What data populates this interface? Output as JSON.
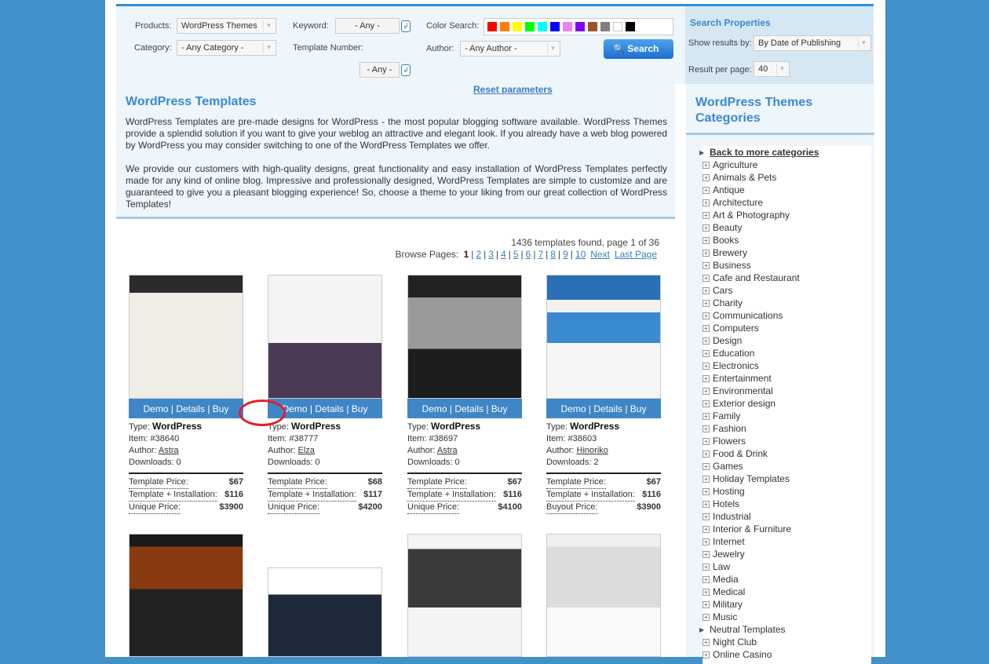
{
  "filters": {
    "products_label": "Products:",
    "products_value": "WordPress Themes",
    "category_label": "Category:",
    "category_value": "- Any Category -",
    "keyword_label": "Keyword:",
    "keyword_value": "- Any -",
    "template_number_label": "Template Number:",
    "template_number_value": "- Any -",
    "color_label": "Color Search:",
    "colors": [
      "#ff0000",
      "#ff8000",
      "#ffff00",
      "#00ff00",
      "#00ffff",
      "#0000ff",
      "#ee82ee",
      "#8000ff",
      "#a0522d",
      "#808080",
      "#ffffff",
      "#000000"
    ],
    "author_label": "Author:",
    "author_value": "- Any Author -",
    "search_label": "Search",
    "reset_label": "Reset parameters"
  },
  "properties": {
    "title": "Search Properties",
    "show_label": "Show results by:",
    "show_value": "By Date of Publishing",
    "per_page_label": "Result per page:",
    "per_page_value": "40"
  },
  "intro": {
    "title": "WordPress Templates",
    "p1": "WordPress Templates are pre-made designs for WordPress - the most popular blogging software available. WordPress Themes provide a splendid solution if you want to give your weblog an attractive and elegant look. If you already have a web blog powered by WordPress you may consider switching to one of the WordPress Templates we offer.",
    "p2": "We provide our customers with high-quality designs, great functionality and easy installation of WordPress Templates perfectly made for any kind of online blog. Impressive and professionally designed, WordPress Templates are simple to customize and are guaranteed to give you a pleasant blogging experience! So, choose a theme to your liking from our great collection of WordPress Templates!"
  },
  "results": {
    "found": "1436 templates found, page 1 of 36",
    "browse_label": "Browse Pages:",
    "current": "1",
    "pages": [
      "2",
      "3",
      "4",
      "5",
      "6",
      "7",
      "8",
      "9",
      "10"
    ],
    "next": "Next",
    "last": "Last Page"
  },
  "cards": [
    {
      "demo": "Demo",
      "details": "Details",
      "buy": "Buy",
      "type_label": "Type:",
      "type": "WordPress",
      "item": "Item: #38640",
      "author_label": "Author:",
      "author": "Astra",
      "downloads": "Downloads: 0",
      "p1_label": "Template Price:",
      "p1": "$67",
      "p2_label": "Template + Installation:",
      "p2": "$116",
      "p3_label": "Unique Price:",
      "p3": "$3900"
    },
    {
      "demo": "Demo",
      "details": "Details",
      "buy": "Buy",
      "type_label": "Type:",
      "type": "WordPress",
      "item": "Item: #38777",
      "author_label": "Author:",
      "author": "Elza",
      "downloads": "Downloads: 0",
      "p1_label": "Template Price:",
      "p1": "$68",
      "p2_label": "Template + Installation:",
      "p2": "$117",
      "p3_label": "Unique Price:",
      "p3": "$4200"
    },
    {
      "demo": "Demo",
      "details": "Details",
      "buy": "Buy",
      "type_label": "Type:",
      "type": "WordPress",
      "item": "Item: #38697",
      "author_label": "Author:",
      "author": "Astra",
      "downloads": "Downloads: 0",
      "p1_label": "Template Price:",
      "p1": "$67",
      "p2_label": "Template + Installation:",
      "p2": "$116",
      "p3_label": "Unique Price:",
      "p3": "$4100"
    },
    {
      "demo": "Demo",
      "details": "Details",
      "buy": "Buy",
      "type_label": "Type:",
      "type": "WordPress",
      "item": "Item: #38603",
      "author_label": "Author:",
      "author": "Hinoriko",
      "downloads": "Downloads: 2",
      "p1_label": "Template Price:",
      "p1": "$67",
      "p2_label": "Template + Installation:",
      "p2": "$116",
      "p3_label": "Buyout Price:",
      "p3": "$3900"
    }
  ],
  "categories": {
    "title": "WordPress Themes Categories",
    "back": "Back to more categories",
    "items": [
      "Agriculture",
      "Animals & Pets",
      "Antique",
      "Architecture",
      "Art & Photography",
      "Beauty",
      "Books",
      "Brewery",
      "Business",
      "Cafe and Restaurant",
      "Cars",
      "Charity",
      "Communications",
      "Computers",
      "Design",
      "Education",
      "Electronics",
      "Entertainment",
      "Environmental",
      "Exterior design",
      "Family",
      "Fashion",
      "Flowers",
      "Food & Drink",
      "Games",
      "Holiday Templates",
      "Hosting",
      "Hotels",
      "Industrial",
      "Interior & Furniture",
      "Internet",
      "Jewelry",
      "Law",
      "Media",
      "Medical",
      "Military",
      "Music",
      "Neutral Templates",
      "Night Club",
      "Online Casino"
    ]
  }
}
